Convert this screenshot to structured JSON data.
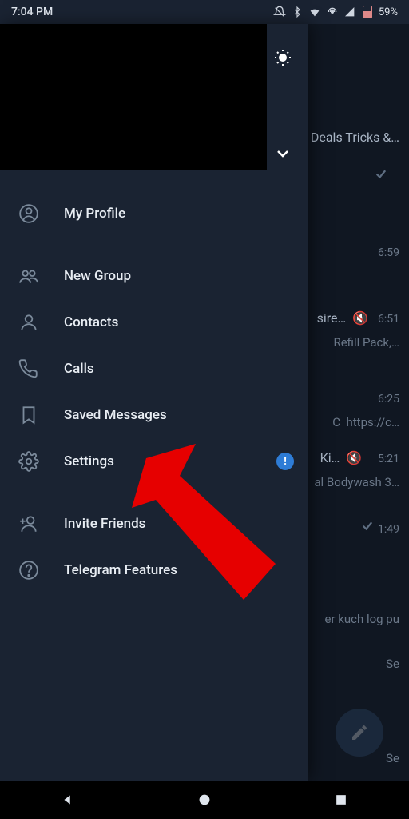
{
  "status": {
    "time": "7:04 PM",
    "battery": "59%"
  },
  "drawer": {
    "my_profile": "My Profile",
    "new_group": "New Group",
    "contacts": "Contacts",
    "calls": "Calls",
    "saved_messages": "Saved Messages",
    "settings": "Settings",
    "invite_friends": "Invite Friends",
    "telegram_features": "Telegram Features",
    "settings_badge": "!"
  },
  "bg": {
    "row1": "Deals Tricks &…",
    "time1": "6:59",
    "row2_title": "sire…",
    "time2": "6:51",
    "row2_sub": "Refill Pack,…",
    "time3": "6:25",
    "row3_sub": "https://c…",
    "row4_title": "Ki…",
    "time4": "5:21",
    "row4_sub": "al Bodywash 3…",
    "time5": "1:49",
    "row5": "er kuch log pu",
    "see1": "Se",
    "see2": "Se"
  }
}
